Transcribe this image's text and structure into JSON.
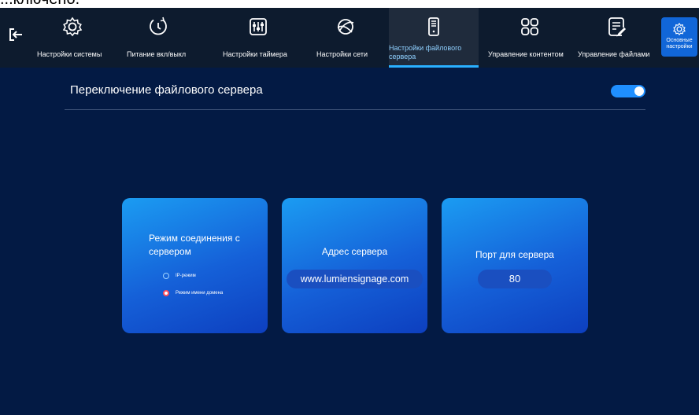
{
  "top_fragment": "...ключено.",
  "nav": {
    "items": [
      {
        "label": "Настройки системы"
      },
      {
        "label": "Питание вкл/выкл"
      },
      {
        "label": "Настройки таймера"
      },
      {
        "label": "Настройки сети"
      },
      {
        "label": "Настройки файлового сервера"
      },
      {
        "label": "Управление контентом"
      },
      {
        "label": "Управление файлами"
      }
    ],
    "basic": {
      "label": "Основные настройки"
    }
  },
  "switch": {
    "title": "Переключение файлового сервера",
    "state": "on"
  },
  "cards": {
    "mode": {
      "title": "Режим соединения с сервером",
      "options": [
        {
          "label": "IP-режим",
          "selected": false
        },
        {
          "label": "Режим имени домена",
          "selected": true
        }
      ]
    },
    "address": {
      "title": "Адрес сервера",
      "value": "www.lumiensignage.com"
    },
    "port": {
      "title": "Порт для сервера",
      "value": "80"
    }
  },
  "colors": {
    "background": "#031a44",
    "nav_bg": "#0d1b2e",
    "accent": "#2ab0ff",
    "toggle_on": "#1f8fff",
    "radio_selected": "#ff4d5a"
  },
  "icons": [
    "exit-icon",
    "gear-icon",
    "power-timer-icon",
    "sliders-icon",
    "network-icon",
    "server-icon",
    "grid-icon",
    "file-edit-icon"
  ]
}
